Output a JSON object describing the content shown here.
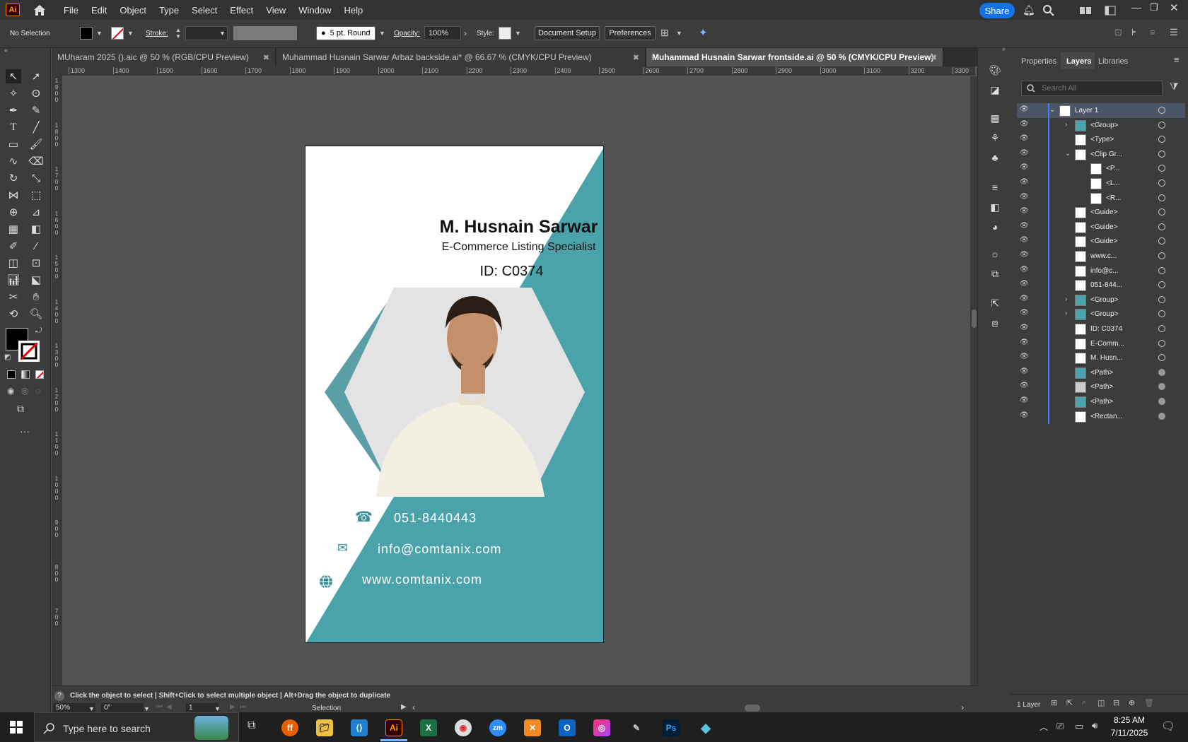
{
  "menubar": {
    "app_logo": "Ai",
    "items": [
      "File",
      "Edit",
      "Object",
      "Type",
      "Select",
      "Effect",
      "View",
      "Window",
      "Help"
    ],
    "share_label": "Share"
  },
  "controlbar": {
    "selection_label": "No Selection",
    "stroke_label": "Stroke:",
    "brush_label": "5 pt. Round",
    "opacity_label": "Opacity:",
    "opacity_value": "100%",
    "style_label": "Style:",
    "document_setup_label": "Document Setup",
    "preferences_label": "Preferences"
  },
  "tabs": [
    {
      "label": "MUharam 2025 ().aic @ 50 % (RGB/CPU Preview)"
    },
    {
      "label": "Muhammad Husnain Sarwar Arbaz backside.ai* @ 66.67 % (CMYK/CPU Preview)"
    },
    {
      "label": "Muhammad Husnain Sarwar frontside.ai @ 50 % (CMYK/CPU Preview)"
    }
  ],
  "ruler": {
    "h_labels": [
      "1300",
      "1400",
      "1500",
      "1600",
      "1700",
      "1800",
      "1900",
      "2000",
      "2100",
      "2200",
      "2300",
      "2400",
      "2500",
      "2600",
      "2700",
      "2800",
      "2900",
      "3000",
      "3100",
      "3200",
      "3300"
    ],
    "v_labels": [
      "1900",
      "1800",
      "1700",
      "1600",
      "1500",
      "1400",
      "1300",
      "1200",
      "1100",
      "1000",
      "900",
      "800",
      "700"
    ]
  },
  "card": {
    "name": "M. Husnain Sarwar",
    "title": "E-Commerce Listing Specialist",
    "id": "ID: C0374",
    "phone": "051-8440443",
    "email": "info@comtanix.com",
    "website": "www.comtanix.com",
    "accent_color": "#4aa3aa",
    "accent_dark": "#5a9ea6"
  },
  "layers_panel": {
    "tabs": [
      "Properties",
      "Layers",
      "Libraries"
    ],
    "search_placeholder": "Search All",
    "layers": [
      {
        "name": "Layer 1"
      },
      {
        "name": "<Group>"
      },
      {
        "name": "<Type>"
      },
      {
        "name": "<Clip Gr..."
      },
      {
        "name": "<P..."
      },
      {
        "name": "<L..."
      },
      {
        "name": "<R..."
      },
      {
        "name": "<Guide>"
      },
      {
        "name": "<Guide>"
      },
      {
        "name": "<Guide>"
      },
      {
        "name": "www.c..."
      },
      {
        "name": "info@c..."
      },
      {
        "name": "051-844..."
      },
      {
        "name": "<Group>"
      },
      {
        "name": "<Group>"
      },
      {
        "name": "ID: C0374"
      },
      {
        "name": "E-Comm..."
      },
      {
        "name": "M. Husn..."
      },
      {
        "name": "<Path>"
      },
      {
        "name": "<Path>"
      },
      {
        "name": "<Path>"
      },
      {
        "name": "<Rectan..."
      }
    ],
    "footer_count": "1 Layer"
  },
  "statusbar": {
    "hint": "Click the object to select  |  Shift+Click to select multiple object  |  Alt+Drag the object to duplicate",
    "zoom": "50%",
    "rotation": "0°",
    "artboard_number": "1",
    "tool_name": "Selection"
  },
  "taskbar": {
    "search_placeholder": "Type here to search",
    "time": "8:25 AM",
    "date": "7/11/2025"
  }
}
